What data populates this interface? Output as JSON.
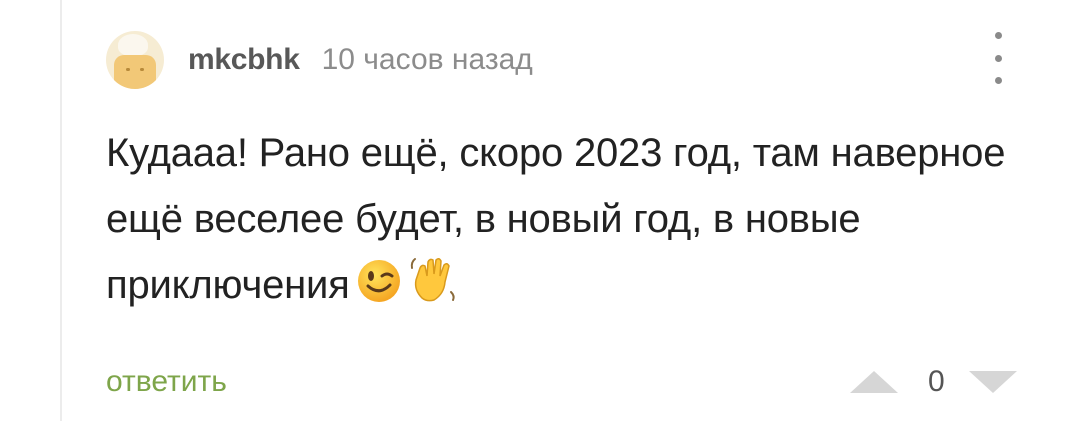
{
  "comment": {
    "author": "mkcbhk",
    "timestamp": "10 часов назад",
    "text": "Кудааа! Рано ещё,  скоро 2023 год, там наверное ещё веселее будет, в новый год, в новые приключения",
    "emojis": [
      "winking-face",
      "waving-hand"
    ],
    "reply_label": "ответить",
    "score": "0"
  },
  "icons": {
    "menu": "vertical-dots-icon",
    "upvote": "triangle-up-icon",
    "downvote": "triangle-down-icon"
  },
  "colors": {
    "reply_link": "#7ea54a",
    "username": "#585858",
    "timestamp": "#8c8c8c",
    "vote_arrows": "#d6d6d6"
  }
}
